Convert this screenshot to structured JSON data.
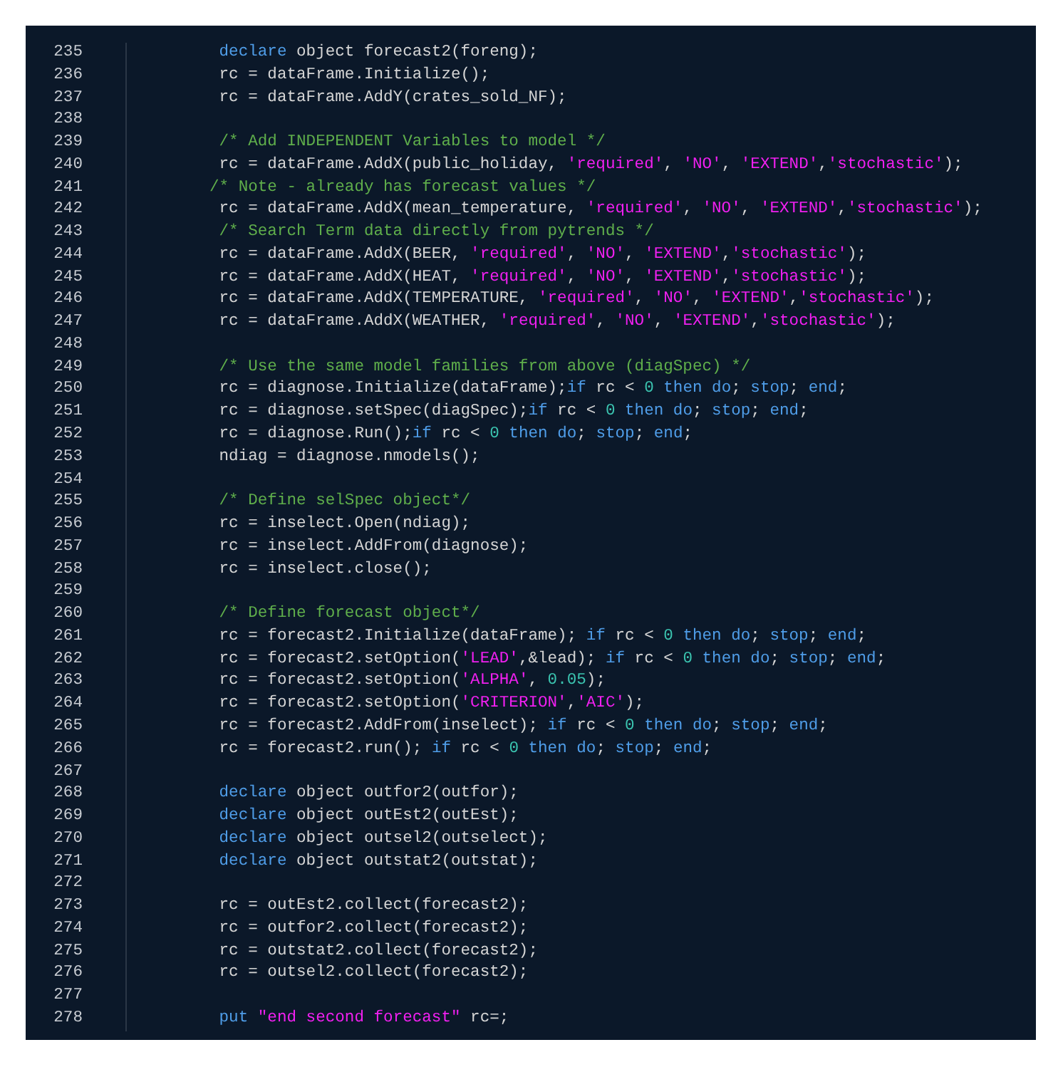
{
  "editor": {
    "lines": [
      {
        "number": "235",
        "tokens": [
          {
            "kind": "keyword",
            "text": " declare"
          },
          {
            "kind": "plain",
            "text": " object forecast2(foreng);"
          }
        ]
      },
      {
        "number": "236",
        "tokens": [
          {
            "kind": "plain",
            "text": " rc = dataFrame.Initialize();"
          }
        ]
      },
      {
        "number": "237",
        "tokens": [
          {
            "kind": "plain",
            "text": " rc = dataFrame.AddY(crates_sold_NF);"
          }
        ]
      },
      {
        "number": "238"
      },
      {
        "number": "239",
        "tokens": [
          {
            "kind": "comment",
            "text": " /* Add INDEPENDENT Variables to model */"
          }
        ]
      },
      {
        "number": "240",
        "tokens": [
          {
            "kind": "plain",
            "text": " rc = dataFrame.AddX(public_holiday, "
          },
          {
            "kind": "string",
            "text": "'required'"
          },
          {
            "kind": "plain",
            "text": ", "
          },
          {
            "kind": "string",
            "text": "'NO'"
          },
          {
            "kind": "plain",
            "text": ", "
          },
          {
            "kind": "string",
            "text": "'EXTEND'"
          },
          {
            "kind": "plain",
            "text": ","
          },
          {
            "kind": "string",
            "text": "'stochastic'"
          },
          {
            "kind": "plain",
            "text": ");"
          }
        ]
      },
      {
        "number": "241",
        "tokens": [
          {
            "kind": "comment",
            "text": "/* Note - already has forecast values */"
          }
        ]
      },
      {
        "number": "242",
        "tokens": [
          {
            "kind": "plain",
            "text": " rc = dataFrame.AddX(mean_temperature, "
          },
          {
            "kind": "string",
            "text": "'required'"
          },
          {
            "kind": "plain",
            "text": ", "
          },
          {
            "kind": "string",
            "text": "'NO'"
          },
          {
            "kind": "plain",
            "text": ", "
          },
          {
            "kind": "string",
            "text": "'EXTEND'"
          },
          {
            "kind": "plain",
            "text": ","
          },
          {
            "kind": "string",
            "text": "'stochastic'"
          },
          {
            "kind": "plain",
            "text": ");"
          }
        ]
      },
      {
        "number": "243",
        "tokens": [
          {
            "kind": "comment",
            "text": " /* Search Term data directly from pytrends */"
          }
        ]
      },
      {
        "number": "244",
        "tokens": [
          {
            "kind": "plain",
            "text": " rc = dataFrame.AddX(BEER, "
          },
          {
            "kind": "string",
            "text": "'required'"
          },
          {
            "kind": "plain",
            "text": ", "
          },
          {
            "kind": "string",
            "text": "'NO'"
          },
          {
            "kind": "plain",
            "text": ", "
          },
          {
            "kind": "string",
            "text": "'EXTEND'"
          },
          {
            "kind": "plain",
            "text": ","
          },
          {
            "kind": "string",
            "text": "'stochastic'"
          },
          {
            "kind": "plain",
            "text": ");"
          }
        ]
      },
      {
        "number": "245",
        "tokens": [
          {
            "kind": "plain",
            "text": " rc = dataFrame.AddX(HEAT, "
          },
          {
            "kind": "string",
            "text": "'required'"
          },
          {
            "kind": "plain",
            "text": ", "
          },
          {
            "kind": "string",
            "text": "'NO'"
          },
          {
            "kind": "plain",
            "text": ", "
          },
          {
            "kind": "string",
            "text": "'EXTEND'"
          },
          {
            "kind": "plain",
            "text": ","
          },
          {
            "kind": "string",
            "text": "'stochastic'"
          },
          {
            "kind": "plain",
            "text": ");"
          }
        ]
      },
      {
        "number": "246",
        "tokens": [
          {
            "kind": "plain",
            "text": " rc = dataFrame.AddX(TEMPERATURE, "
          },
          {
            "kind": "string",
            "text": "'required'"
          },
          {
            "kind": "plain",
            "text": ", "
          },
          {
            "kind": "string",
            "text": "'NO'"
          },
          {
            "kind": "plain",
            "text": ", "
          },
          {
            "kind": "string",
            "text": "'EXTEND'"
          },
          {
            "kind": "plain",
            "text": ","
          },
          {
            "kind": "string",
            "text": "'stochastic'"
          },
          {
            "kind": "plain",
            "text": ");"
          }
        ]
      },
      {
        "number": "247",
        "tokens": [
          {
            "kind": "plain",
            "text": " rc = dataFrame.AddX(WEATHER, "
          },
          {
            "kind": "string",
            "text": "'required'"
          },
          {
            "kind": "plain",
            "text": ", "
          },
          {
            "kind": "string",
            "text": "'NO'"
          },
          {
            "kind": "plain",
            "text": ", "
          },
          {
            "kind": "string",
            "text": "'EXTEND'"
          },
          {
            "kind": "plain",
            "text": ","
          },
          {
            "kind": "string",
            "text": "'stochastic'"
          },
          {
            "kind": "plain",
            "text": ");"
          }
        ]
      },
      {
        "number": "248"
      },
      {
        "number": "249",
        "tokens": [
          {
            "kind": "comment",
            "text": " /* Use the same model families from above (diagSpec) */"
          }
        ]
      },
      {
        "number": "250",
        "tokens": [
          {
            "kind": "plain",
            "text": " rc = diagnose.Initialize(dataFrame);"
          },
          {
            "kind": "keyword",
            "text": "if"
          },
          {
            "kind": "plain",
            "text": " rc < "
          },
          {
            "kind": "number",
            "text": "0"
          },
          {
            "kind": "keyword",
            "text": " then do"
          },
          {
            "kind": "plain",
            "text": "; "
          },
          {
            "kind": "keyword",
            "text": "stop"
          },
          {
            "kind": "plain",
            "text": "; "
          },
          {
            "kind": "keyword",
            "text": "end"
          },
          {
            "kind": "plain",
            "text": ";"
          }
        ]
      },
      {
        "number": "251",
        "tokens": [
          {
            "kind": "plain",
            "text": " rc = diagnose.setSpec(diagSpec);"
          },
          {
            "kind": "keyword",
            "text": "if"
          },
          {
            "kind": "plain",
            "text": " rc < "
          },
          {
            "kind": "number",
            "text": "0"
          },
          {
            "kind": "keyword",
            "text": " then do"
          },
          {
            "kind": "plain",
            "text": "; "
          },
          {
            "kind": "keyword",
            "text": "stop"
          },
          {
            "kind": "plain",
            "text": "; "
          },
          {
            "kind": "keyword",
            "text": "end"
          },
          {
            "kind": "plain",
            "text": ";"
          }
        ]
      },
      {
        "number": "252",
        "tokens": [
          {
            "kind": "plain",
            "text": " rc = diagnose.Run();"
          },
          {
            "kind": "keyword",
            "text": "if"
          },
          {
            "kind": "plain",
            "text": " rc < "
          },
          {
            "kind": "number",
            "text": "0"
          },
          {
            "kind": "keyword",
            "text": " then do"
          },
          {
            "kind": "plain",
            "text": "; "
          },
          {
            "kind": "keyword",
            "text": "stop"
          },
          {
            "kind": "plain",
            "text": "; "
          },
          {
            "kind": "keyword",
            "text": "end"
          },
          {
            "kind": "plain",
            "text": ";"
          }
        ]
      },
      {
        "number": "253",
        "tokens": [
          {
            "kind": "plain",
            "text": " ndiag = diagnose.nmodels();"
          }
        ]
      },
      {
        "number": "254"
      },
      {
        "number": "255",
        "tokens": [
          {
            "kind": "comment",
            "text": " /* Define selSpec object*/"
          }
        ]
      },
      {
        "number": "256",
        "tokens": [
          {
            "kind": "plain",
            "text": " rc = inselect.Open(ndiag);"
          }
        ]
      },
      {
        "number": "257",
        "tokens": [
          {
            "kind": "plain",
            "text": " rc = inselect.AddFrom(diagnose);"
          }
        ]
      },
      {
        "number": "258",
        "tokens": [
          {
            "kind": "plain",
            "text": " rc = inselect.close();"
          }
        ]
      },
      {
        "number": "259"
      },
      {
        "number": "260",
        "tokens": [
          {
            "kind": "comment",
            "text": " /* Define forecast object*/"
          }
        ]
      },
      {
        "number": "261",
        "tokens": [
          {
            "kind": "plain",
            "text": " rc = forecast2.Initialize(dataFrame); "
          },
          {
            "kind": "keyword",
            "text": "if"
          },
          {
            "kind": "plain",
            "text": " rc < "
          },
          {
            "kind": "number",
            "text": "0"
          },
          {
            "kind": "keyword",
            "text": " then do"
          },
          {
            "kind": "plain",
            "text": "; "
          },
          {
            "kind": "keyword",
            "text": "stop"
          },
          {
            "kind": "plain",
            "text": "; "
          },
          {
            "kind": "keyword",
            "text": "end"
          },
          {
            "kind": "plain",
            "text": ";"
          }
        ]
      },
      {
        "number": "262",
        "tokens": [
          {
            "kind": "plain",
            "text": " rc = forecast2.setOption("
          },
          {
            "kind": "string",
            "text": "'LEAD'"
          },
          {
            "kind": "plain",
            "text": ",&lead); "
          },
          {
            "kind": "keyword",
            "text": "if"
          },
          {
            "kind": "plain",
            "text": " rc < "
          },
          {
            "kind": "number",
            "text": "0"
          },
          {
            "kind": "keyword",
            "text": " then do"
          },
          {
            "kind": "plain",
            "text": "; "
          },
          {
            "kind": "keyword",
            "text": "stop"
          },
          {
            "kind": "plain",
            "text": "; "
          },
          {
            "kind": "keyword",
            "text": "end"
          },
          {
            "kind": "plain",
            "text": ";"
          }
        ]
      },
      {
        "number": "263",
        "tokens": [
          {
            "kind": "plain",
            "text": " rc = forecast2.setOption("
          },
          {
            "kind": "string",
            "text": "'ALPHA'"
          },
          {
            "kind": "plain",
            "text": ", "
          },
          {
            "kind": "number",
            "text": "0.05"
          },
          {
            "kind": "plain",
            "text": ");"
          }
        ]
      },
      {
        "number": "264",
        "tokens": [
          {
            "kind": "plain",
            "text": " rc = forecast2.setOption("
          },
          {
            "kind": "string",
            "text": "'CRITERION'"
          },
          {
            "kind": "plain",
            "text": ","
          },
          {
            "kind": "string",
            "text": "'AIC'"
          },
          {
            "kind": "plain",
            "text": ");"
          }
        ]
      },
      {
        "number": "265",
        "tokens": [
          {
            "kind": "plain",
            "text": " rc = forecast2.AddFrom(inselect); "
          },
          {
            "kind": "keyword",
            "text": "if"
          },
          {
            "kind": "plain",
            "text": " rc < "
          },
          {
            "kind": "number",
            "text": "0"
          },
          {
            "kind": "keyword",
            "text": " then do"
          },
          {
            "kind": "plain",
            "text": "; "
          },
          {
            "kind": "keyword",
            "text": "stop"
          },
          {
            "kind": "plain",
            "text": "; "
          },
          {
            "kind": "keyword",
            "text": "end"
          },
          {
            "kind": "plain",
            "text": ";"
          }
        ]
      },
      {
        "number": "266",
        "tokens": [
          {
            "kind": "plain",
            "text": " rc = forecast2.run(); "
          },
          {
            "kind": "keyword",
            "text": "if"
          },
          {
            "kind": "plain",
            "text": " rc < "
          },
          {
            "kind": "number",
            "text": "0"
          },
          {
            "kind": "keyword",
            "text": " then do"
          },
          {
            "kind": "plain",
            "text": "; "
          },
          {
            "kind": "keyword",
            "text": "stop"
          },
          {
            "kind": "plain",
            "text": "; "
          },
          {
            "kind": "keyword",
            "text": "end"
          },
          {
            "kind": "plain",
            "text": ";"
          }
        ]
      },
      {
        "number": "267"
      },
      {
        "number": "268",
        "tokens": [
          {
            "kind": "keyword",
            "text": " declare"
          },
          {
            "kind": "plain",
            "text": " object outfor2(outfor);"
          }
        ]
      },
      {
        "number": "269",
        "tokens": [
          {
            "kind": "keyword",
            "text": " declare"
          },
          {
            "kind": "plain",
            "text": " object outEst2(outEst);"
          }
        ]
      },
      {
        "number": "270",
        "tokens": [
          {
            "kind": "keyword",
            "text": " declare"
          },
          {
            "kind": "plain",
            "text": " object outsel2(outselect);"
          }
        ]
      },
      {
        "number": "271",
        "tokens": [
          {
            "kind": "keyword",
            "text": " declare"
          },
          {
            "kind": "plain",
            "text": " object outstat2(outstat);"
          }
        ]
      },
      {
        "number": "272"
      },
      {
        "number": "273",
        "tokens": [
          {
            "kind": "plain",
            "text": " rc = outEst2.collect(forecast2);"
          }
        ]
      },
      {
        "number": "274",
        "tokens": [
          {
            "kind": "plain",
            "text": " rc = outfor2.collect(forecast2);"
          }
        ]
      },
      {
        "number": "275",
        "tokens": [
          {
            "kind": "plain",
            "text": " rc = outstat2.collect(forecast2);"
          }
        ]
      },
      {
        "number": "276",
        "tokens": [
          {
            "kind": "plain",
            "text": " rc = outsel2.collect(forecast2);"
          }
        ]
      },
      {
        "number": "277"
      },
      {
        "number": "278",
        "tokens": [
          {
            "kind": "keyword",
            "text": " put"
          },
          {
            "kind": "string",
            "text": " \"end second forecast\""
          },
          {
            "kind": "plain",
            "text": " rc=;"
          }
        ]
      }
    ]
  }
}
